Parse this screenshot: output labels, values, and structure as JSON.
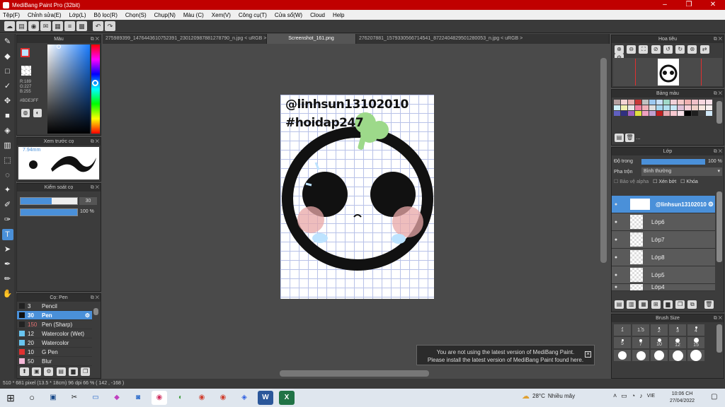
{
  "window": {
    "title": "MediBang Paint Pro (32bit)"
  },
  "menu": [
    "Tệp(F)",
    "Chỉnh sửa(E)",
    "Lớp(L)",
    "Bộ lọc(R)",
    "Chọn(S)",
    "Chụp(N)",
    "Màu (C)",
    "Xem(V)",
    "Công cụ(T)",
    "Cửa sổ(W)",
    "Cloud",
    "Help"
  ],
  "tabs": [
    "275989399_1476443610752391_230120987881278790_n.jpg < uRGB >",
    "Screenshot_161.png",
    "276207881_1579330566714541_8722404829501280053_n.jpg < uRGB >"
  ],
  "color_panel": {
    "title": "Màu",
    "r": "R:189",
    "g": "G:227",
    "b": "B:255",
    "hex": "#BDE3FF",
    "swatch_color": "#bde3ff"
  },
  "brush_preview": {
    "title": "Xem trước cọ",
    "size_label": "7.94mm"
  },
  "brush_control": {
    "title": "Kiểm soát cọ",
    "size": "30",
    "opacity": "100 %"
  },
  "brush_list": {
    "title": "Cọ: Pen",
    "items": [
      {
        "size": "3",
        "name": "Pencil",
        "color": "#222222"
      },
      {
        "size": "30",
        "name": "Pen",
        "color": "#111111",
        "active": true
      },
      {
        "size": "150",
        "name": "Pen (Sharp)",
        "color": "#222222"
      },
      {
        "size": "12",
        "name": "Watercolor (Wet)",
        "color": "#69c5f0"
      },
      {
        "size": "20",
        "name": "Watercolor",
        "color": "#69c5f0"
      },
      {
        "size": "10",
        "name": "G Pen",
        "color": "#e03030"
      },
      {
        "size": "50",
        "name": "Blur",
        "color": "#f5b8d8"
      }
    ]
  },
  "canvas": {
    "line1": "@linhsun13102010",
    "line2": "#hoidap247"
  },
  "notification": {
    "line1": "You are not using the latest version of MediBang Paint.",
    "line2": "Please install the latest version of MediBang Paint found here."
  },
  "navigator": {
    "title": "Hoa tiêu"
  },
  "palette_panel": {
    "title": "Bảng màu",
    "ellipsis": "..."
  },
  "layer_panel": {
    "title": "Lớp",
    "opacity_label": "Độ trong",
    "opacity_value": "100 %",
    "blend_label": "Pha trộn",
    "blend_value": "Bình thường",
    "protect_alpha": "Bảo vệ alpha",
    "clipping": "Xén bớt",
    "lock": "Khóa",
    "layers": [
      "@linhsun13102010",
      "Lớp6",
      "Lớp7",
      "Lớp8",
      "Lớp5",
      "Lớp4"
    ]
  },
  "brush_size": {
    "title": "Brush Size",
    "labels": [
      "1",
      "1.5",
      "2",
      "3",
      "4",
      "5",
      "7",
      "10",
      "12",
      "15"
    ]
  },
  "status": "510 * 681 pixel   (13.5 * 18cm)   96 dpi   66 %   ( 142 , -168 )",
  "taskbar": {
    "weather_temp": "28°C",
    "weather_desc": "Nhiều mây",
    "lang": "VIE",
    "time": "10:06 CH",
    "date": "27/04/2022"
  },
  "colors": {
    "accent": "#4a90d9",
    "titlebar": "#c00000"
  }
}
